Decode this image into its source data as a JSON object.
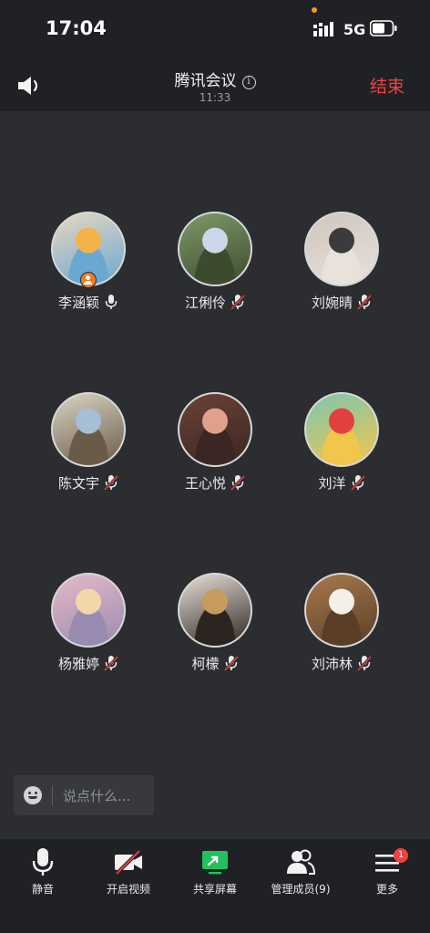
{
  "status": {
    "time": "17:04",
    "network": "5G"
  },
  "header": {
    "title": "腾讯会议",
    "info_glyph": "i",
    "duration": "11:33",
    "end_label": "结束"
  },
  "participants": [
    {
      "name": "李涵颖",
      "mic": "on",
      "host": true,
      "palette": [
        "#e6d7c0",
        "#f4b24a",
        "#6aa8d2"
      ]
    },
    {
      "name": "江俐伶",
      "mic": "muted",
      "host": false,
      "palette": [
        "#7f9a6a",
        "#c9d7e8",
        "#3c4a2e"
      ]
    },
    {
      "name": "刘婉晴",
      "mic": "muted",
      "host": false,
      "palette": [
        "#cfc6bd",
        "#3b3b3b",
        "#e8e2db"
      ]
    },
    {
      "name": "陈文宇",
      "mic": "muted",
      "host": false,
      "palette": [
        "#d9d4c4",
        "#a6bfd6",
        "#6a5a48"
      ]
    },
    {
      "name": "王心悦",
      "mic": "muted",
      "host": false,
      "palette": [
        "#6b4238",
        "#e0a18c",
        "#3a2622"
      ]
    },
    {
      "name": "刘洋",
      "mic": "muted",
      "host": false,
      "palette": [
        "#7ec7b0",
        "#e3403f",
        "#f2c54b"
      ]
    },
    {
      "name": "杨雅婷",
      "mic": "muted",
      "host": false,
      "palette": [
        "#e6b9c8",
        "#f3d7a8",
        "#9a8bb0"
      ]
    },
    {
      "name": "柯檬",
      "mic": "muted",
      "host": false,
      "palette": [
        "#e8e1d8",
        "#c79a5e",
        "#2c2420"
      ]
    },
    {
      "name": "刘沛林",
      "mic": "muted",
      "host": false,
      "palette": [
        "#a87a4e",
        "#f4f0e8",
        "#5a3e26"
      ]
    }
  ],
  "chat": {
    "placeholder": "说点什么..."
  },
  "toolbar": {
    "items": [
      {
        "label": "静音",
        "icon": "microphone-icon"
      },
      {
        "label": "开启视频",
        "icon": "video-off-icon"
      },
      {
        "label": "共享屏幕",
        "icon": "share-screen-icon"
      },
      {
        "label": "管理成员(9)",
        "icon": "members-icon"
      },
      {
        "label": "更多",
        "icon": "menu-icon",
        "badge": "1"
      }
    ]
  },
  "colors": {
    "accent_end": "#f0433e",
    "share_green": "#21c25e",
    "host_orange": "#f07b22",
    "mute_red": "#e0403a"
  }
}
